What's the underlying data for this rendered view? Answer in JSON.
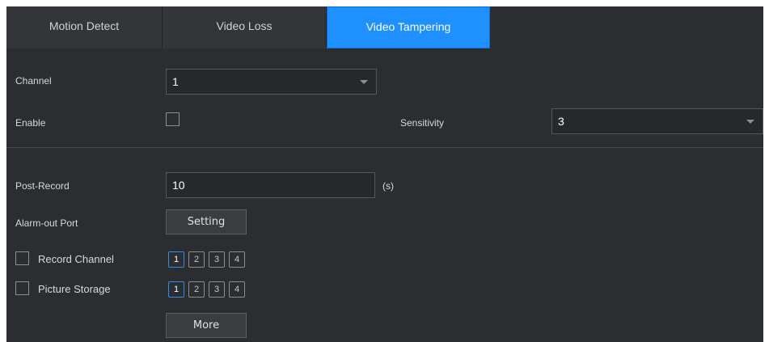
{
  "tabs": [
    {
      "label": "Motion Detect"
    },
    {
      "label": "Video Loss"
    },
    {
      "label": "Video Tampering"
    }
  ],
  "active_tab": "Video Tampering",
  "form": {
    "channel_label": "Channel",
    "channel_value": "1",
    "enable_label": "Enable",
    "sensitivity_label": "Sensitivity",
    "sensitivity_value": "3",
    "post_record_label": "Post-Record",
    "post_record_value": "10",
    "post_record_unit": "(s)",
    "alarm_out_label": "Alarm-out Port",
    "setting_button": "Setting",
    "record_channel_label": "Record Channel",
    "record_channels": [
      "1",
      "2",
      "3",
      "4"
    ],
    "picture_storage_label": "Picture Storage",
    "picture_channels": [
      "1",
      "2",
      "3",
      "4"
    ],
    "more_button": "More"
  },
  "colors": {
    "panel_bg": "#2b2d31",
    "tab_active": "#1e90ff",
    "selected_channel_border": "#2f8fe8"
  }
}
